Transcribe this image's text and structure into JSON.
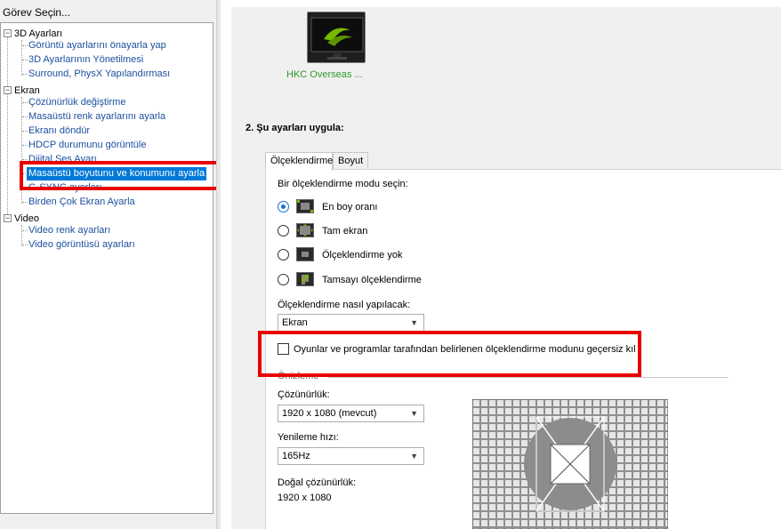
{
  "left_panel": {
    "header": "Görev Seçin...",
    "categories": [
      {
        "label": "3D Ayarları",
        "children": [
          "Görüntü ayarlarını önayarla yap",
          "3D Ayarlarının Yönetilmesi",
          "Surround, PhysX Yapılandırması"
        ]
      },
      {
        "label": "Ekran",
        "children": [
          "Çözünürlük değiştirme",
          "Masaüstü renk ayarlarını ayarla",
          "Ekranı döndür",
          "HDCP durumunu görüntüle",
          "Dijital Ses Ayarı",
          "Masaüstü boyutunu ve konumunu ayarla",
          "G-SYNC ayarları",
          "Birden Çok Ekran Ayarla"
        ]
      },
      {
        "label": "Video",
        "children": [
          "Video renk ayarları",
          "Video görüntüsü ayarları"
        ]
      }
    ],
    "selected_item": "Masaüstü boyutunu ve konumunu ayarla"
  },
  "right_panel": {
    "monitor_label": "HKC Overseas ...",
    "section_title": "2. Şu ayarları uygula:",
    "tabs": [
      {
        "label": "Ölçeklendirme",
        "active": true
      },
      {
        "label": "Boyut",
        "active": false
      }
    ],
    "scaling": {
      "mode_prompt": "Bir ölçeklendirme modu seçin:",
      "modes": [
        {
          "label": "En boy oranı",
          "selected": true
        },
        {
          "label": "Tam ekran",
          "selected": false
        },
        {
          "label": "Ölçeklendirme yok",
          "selected": false
        },
        {
          "label": "Tamsayı ölçeklendirme",
          "selected": false
        }
      ],
      "perform_label": "Ölçeklendirme nasıl yapılacak:",
      "perform_value": "Ekran",
      "override_label": "Oyunlar ve programlar tarafından belirlenen ölçeklendirme modunu geçersiz kıl",
      "override_checked": false
    },
    "preview": {
      "section_label": "Önizleme",
      "resolution_label": "Çözünürlük:",
      "resolution_value": "1920 x 1080 (mevcut)",
      "refresh_label": "Yenileme hızı:",
      "refresh_value": "165Hz",
      "native_label": "Doğal çözünürlük:",
      "native_value": "1920 x 1080"
    }
  },
  "colors": {
    "selection": "#0078d7",
    "link": "#1a4f9e",
    "monitor_label": "#2d9a2d",
    "highlight_box": "#e80000",
    "nvidia_green": "#76b900"
  },
  "icons": {
    "monitor": "nvidia-monitor-icon",
    "tree_expander": "tree-collapse-icon",
    "dropdown": "chevron-down-icon"
  }
}
